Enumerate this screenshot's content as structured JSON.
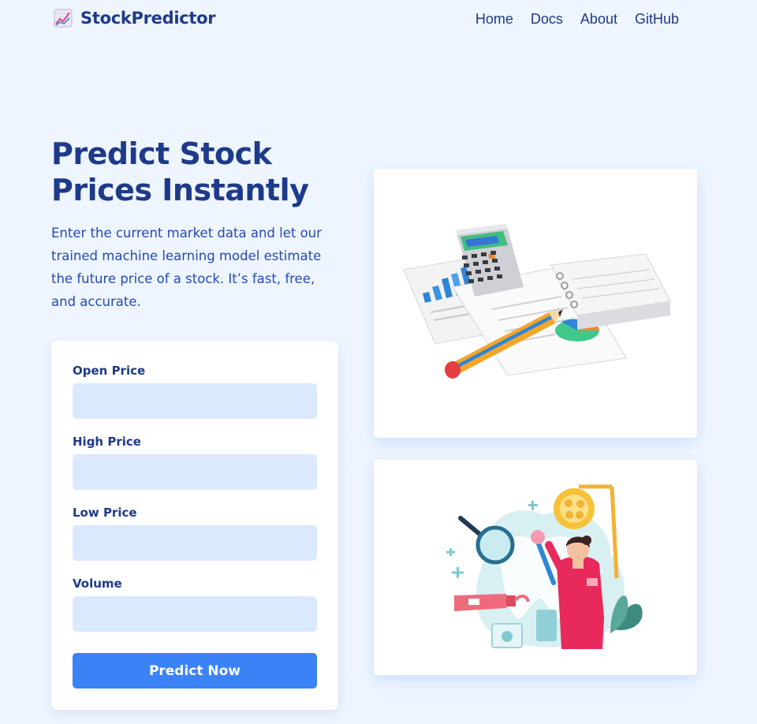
{
  "brand": {
    "name": "StockPredictor",
    "icon": "chart-upward-icon"
  },
  "nav": {
    "items": [
      "Home",
      "Docs",
      "About",
      "GitHub"
    ]
  },
  "hero": {
    "title": "Predict Stock Prices Instantly",
    "description": "Enter the current market data and let our trained machine learning model estimate the future price of a stock. It’s fast, free, and accurate."
  },
  "form": {
    "fields": [
      {
        "label": "Open Price",
        "value": ""
      },
      {
        "label": "High Price",
        "value": ""
      },
      {
        "label": "Low Price",
        "value": ""
      },
      {
        "label": "Volume",
        "value": ""
      }
    ],
    "submit_label": "Predict Now"
  },
  "illustrations": [
    {
      "icon": "finance-documents-calculator-illustration"
    },
    {
      "icon": "dentist-toothbrush-illustration"
    }
  ],
  "colors": {
    "background": "#eef5ff",
    "primary": "#1e3a8a",
    "accent": "#3b82f6",
    "input_bg": "#dbe9fe"
  }
}
